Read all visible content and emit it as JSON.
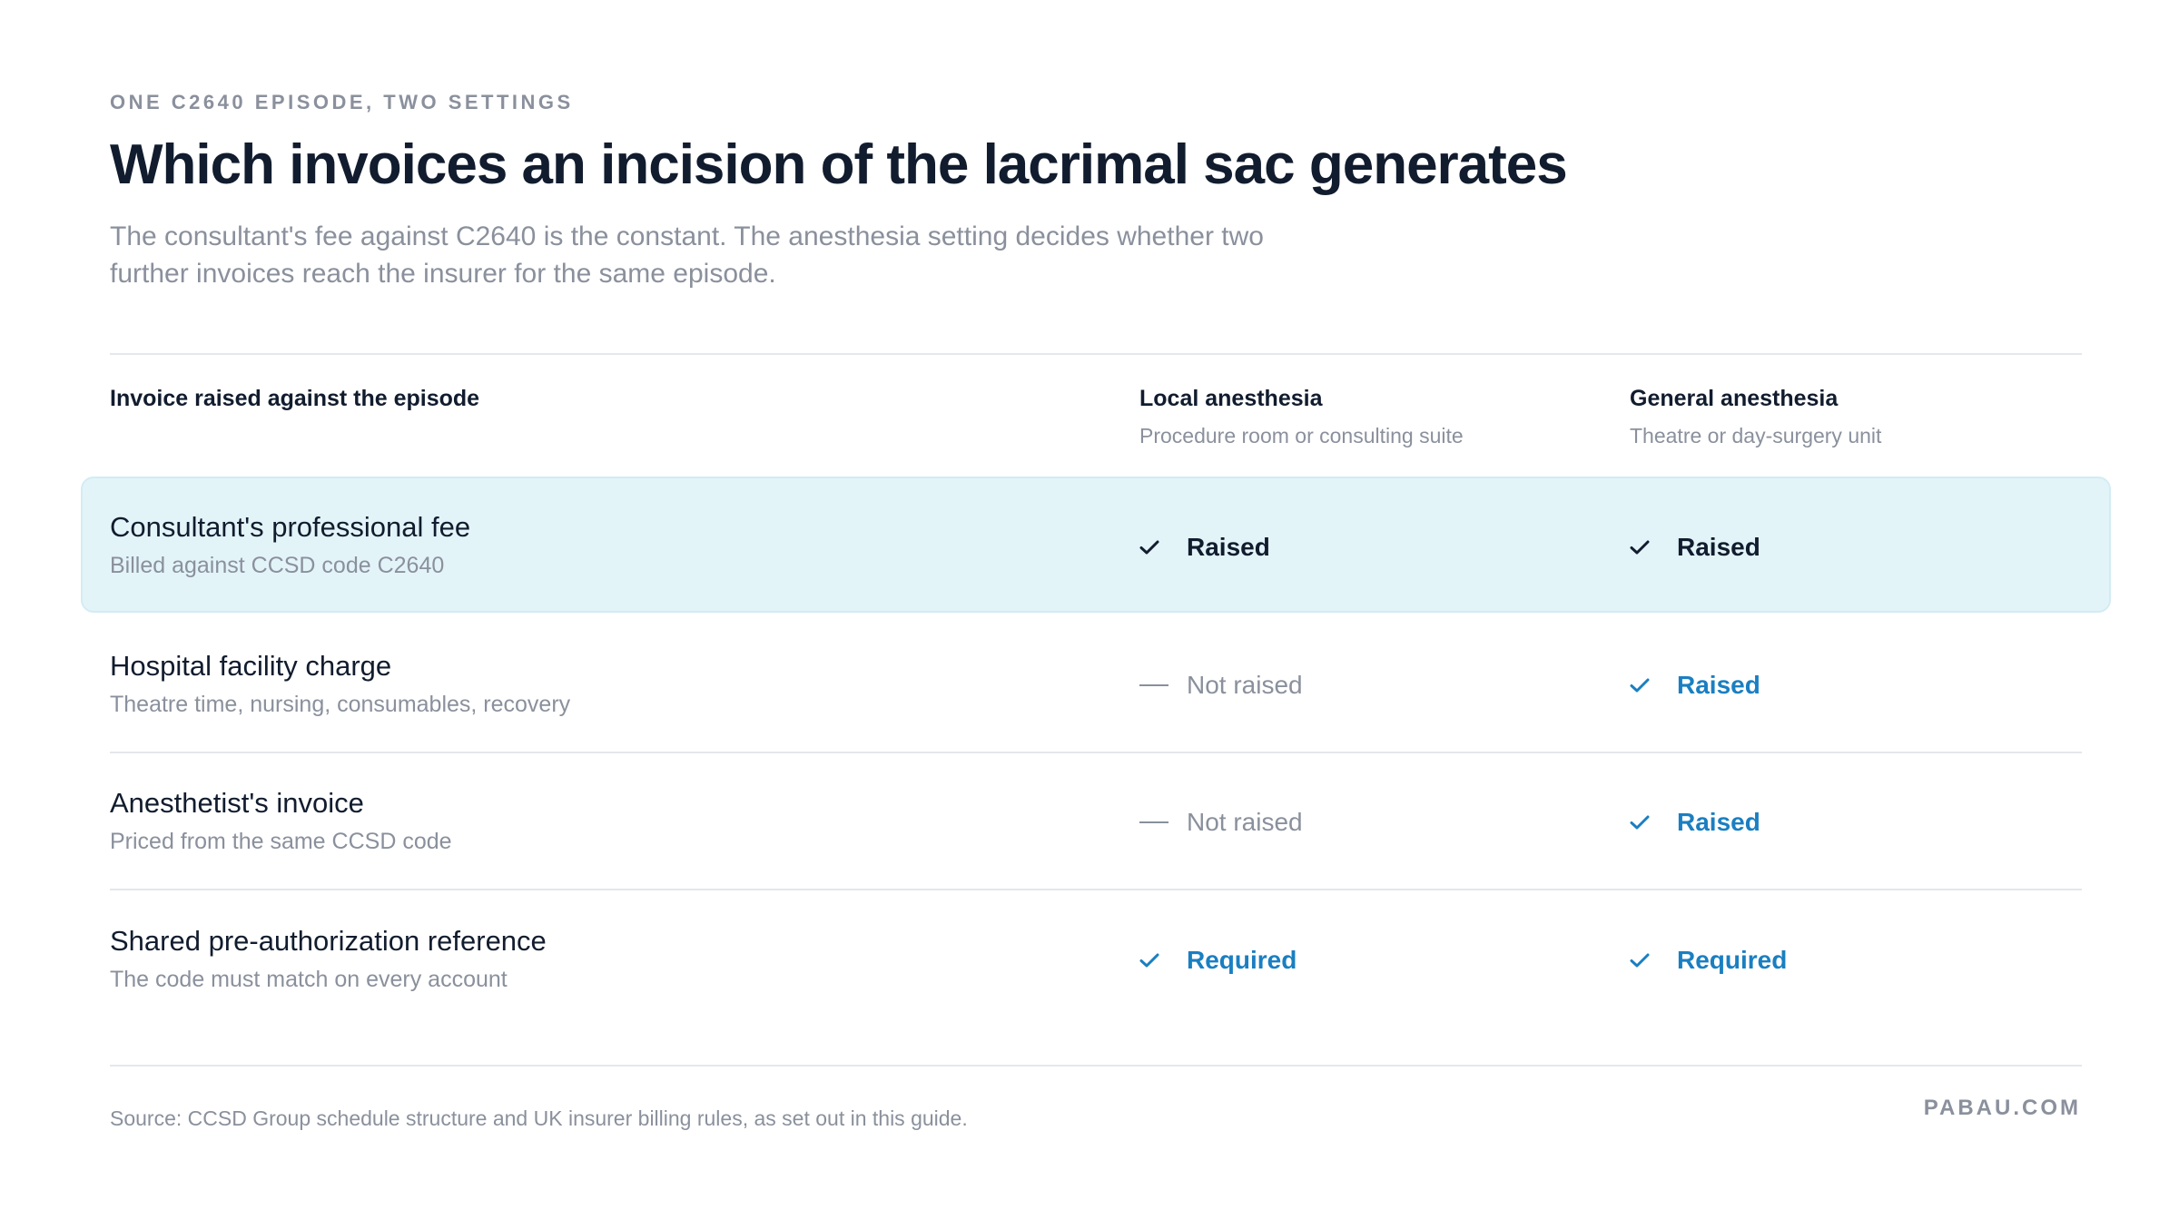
{
  "header": {
    "eyebrow": "ONE C2640 EPISODE, TWO SETTINGS",
    "title": "Which invoices an incision of the lacrimal sac generates",
    "subtitle": "The consultant's fee against C2640 is the constant. The anesthesia setting decides whether two further invoices reach the insurer for the same episode."
  },
  "table": {
    "columns": [
      {
        "label": "Invoice raised against the episode",
        "sub": ""
      },
      {
        "label": "Local anesthesia",
        "sub": "Procedure room or consulting suite"
      },
      {
        "label": "General anesthesia",
        "sub": "Theatre or day-surgery unit"
      }
    ],
    "rows": [
      {
        "title": "Consultant's professional fee",
        "sub": "Billed against CCSD code C2640",
        "highlighted": true,
        "local": {
          "status": "Raised",
          "icon": "check-icon",
          "tone": "dark"
        },
        "general": {
          "status": "Raised",
          "icon": "check-icon",
          "tone": "dark"
        }
      },
      {
        "title": "Hospital facility charge",
        "sub": "Theatre time, nursing, consumables, recovery",
        "highlighted": false,
        "local": {
          "status": "Not raised",
          "icon": "dash-icon",
          "tone": "muted"
        },
        "general": {
          "status": "Raised",
          "icon": "check-icon",
          "tone": "blue"
        }
      },
      {
        "title": "Anesthetist's invoice",
        "sub": "Priced from the same CCSD code",
        "highlighted": false,
        "local": {
          "status": "Not raised",
          "icon": "dash-icon",
          "tone": "muted"
        },
        "general": {
          "status": "Raised",
          "icon": "check-icon",
          "tone": "blue"
        }
      },
      {
        "title": "Shared pre-authorization reference",
        "sub": "The code must match on every account",
        "highlighted": false,
        "local": {
          "status": "Required",
          "icon": "check-icon",
          "tone": "blue"
        },
        "general": {
          "status": "Required",
          "icon": "check-icon",
          "tone": "blue"
        }
      }
    ]
  },
  "footer": {
    "source": "Source: CCSD Group schedule structure and UK insurer billing rules, as set out in this guide.",
    "brand": "PABAU.COM"
  },
  "colors": {
    "text": "#111c2e",
    "muted": "#8a909c",
    "accent": "#1a7fc1",
    "highlight": "#e3f4f9",
    "rule": "#e4e7ec"
  }
}
